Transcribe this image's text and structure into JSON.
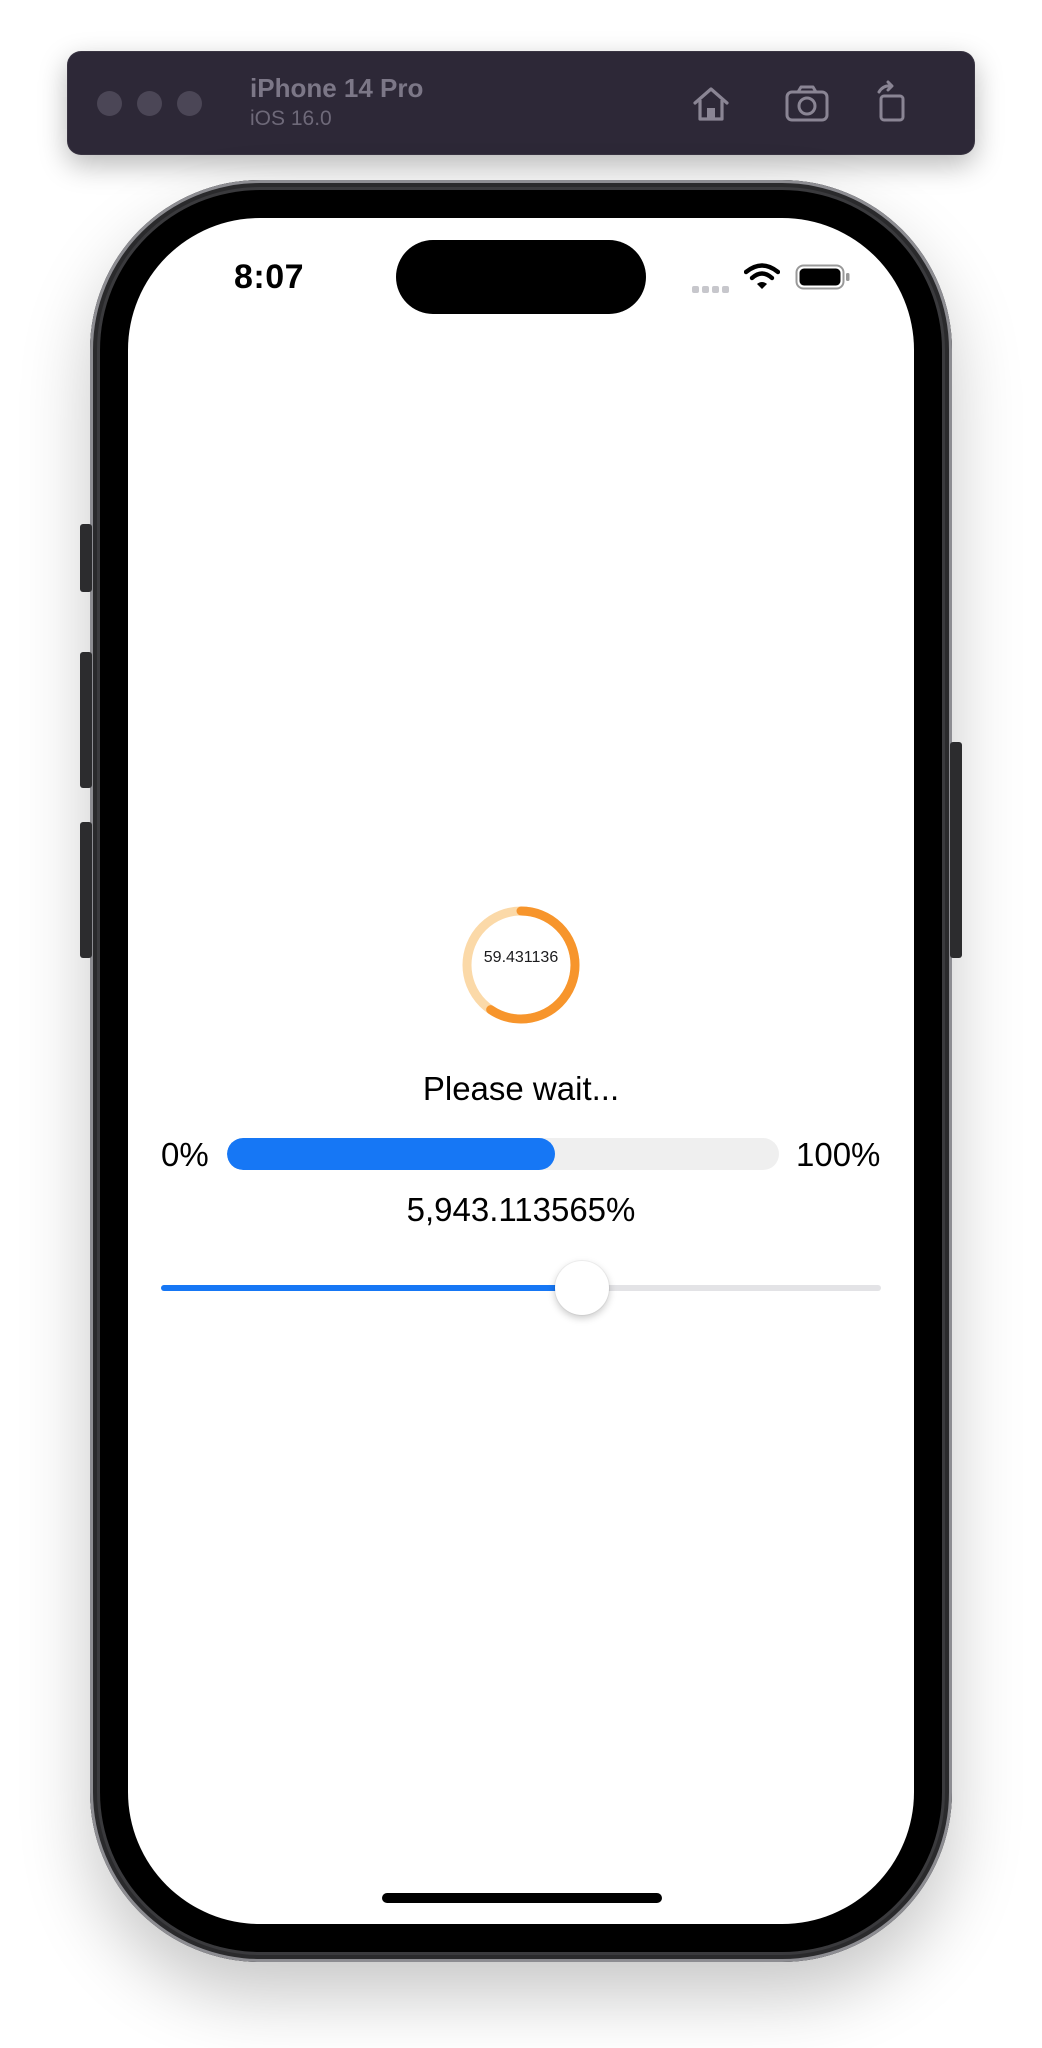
{
  "simulator": {
    "device_name": "iPhone 14 Pro",
    "os_version": "iOS 16.0",
    "toolbar_icons": [
      "home-icon",
      "screenshot-icon",
      "rotate-icon"
    ]
  },
  "status_bar": {
    "time": "8:07",
    "icons": [
      "cellular-signal-icon",
      "wifi-icon",
      "battery-icon"
    ]
  },
  "content": {
    "ring": {
      "label": "59.431136",
      "progress_percent": 59.431136,
      "track_color": "#fbd9a8",
      "progress_color": "#f7952c"
    },
    "status_text": "Please wait...",
    "progress_bar": {
      "min_label": "0%",
      "max_label": "100%",
      "value_fraction": 0.594,
      "fill_color": "#1677f5",
      "track_color": "#efefef"
    },
    "percent_text": "5,943.113565%",
    "slider": {
      "value_fraction": 0.585,
      "accent_color": "#1677f5"
    }
  }
}
